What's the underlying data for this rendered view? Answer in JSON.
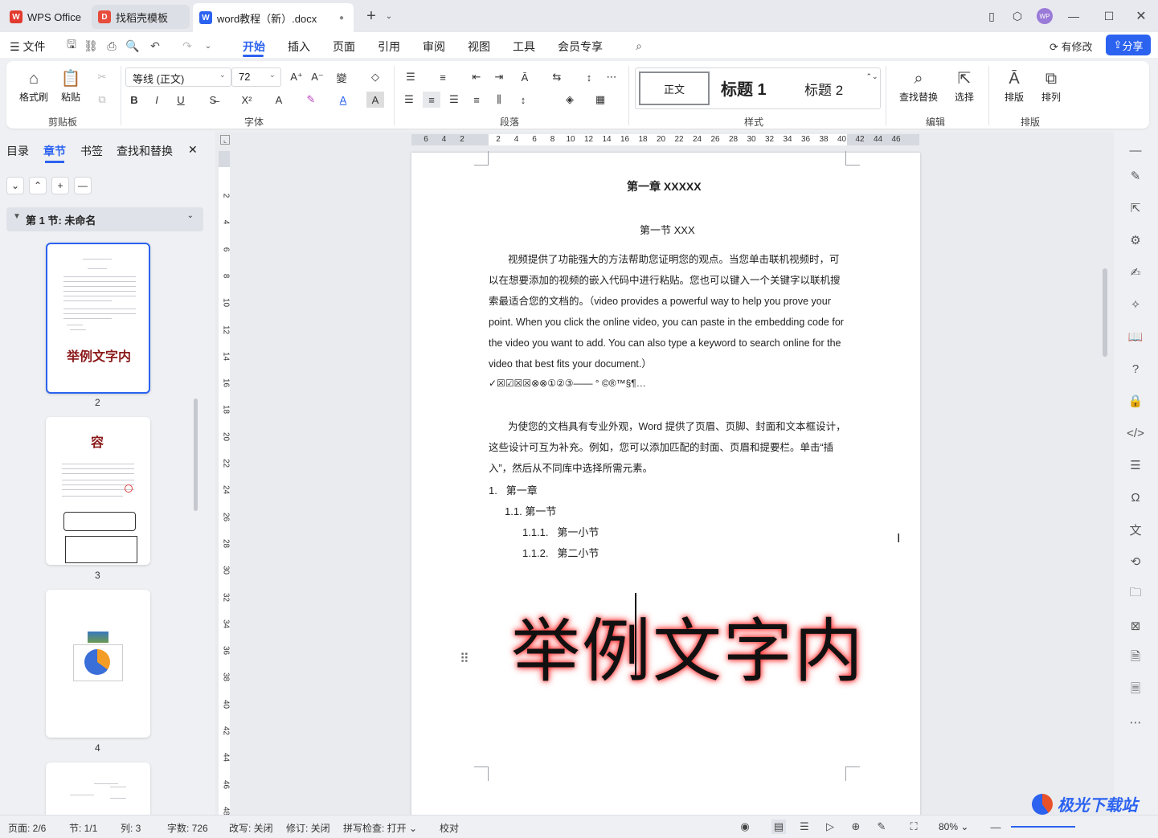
{
  "titlebar": {
    "tabs": [
      {
        "label": "WPS Office",
        "icon": "wps-logo-icon"
      },
      {
        "label": "找稻壳模板",
        "icon": "docer-icon"
      },
      {
        "label": "word教程（新）.docx",
        "icon": "word-doc-icon"
      }
    ],
    "new_tab": "+"
  },
  "menubar": {
    "file": "文件",
    "items": [
      "开始",
      "插入",
      "页面",
      "引用",
      "审阅",
      "视图",
      "工具",
      "会员专享"
    ],
    "active": "开始",
    "modified": "有修改",
    "share": "分享"
  },
  "ribbon": {
    "clipboard": {
      "label": "剪贴板",
      "format_painter": "格式刷",
      "paste": "粘贴"
    },
    "font": {
      "label": "字体",
      "family": "等线 (正文)",
      "size": "72"
    },
    "paragraph": {
      "label": "段落"
    },
    "styles": {
      "label": "样式",
      "normal": "正文",
      "h1": "标题 1",
      "h2": "标题 2"
    },
    "edit": {
      "label": "编辑",
      "find_replace": "查找替换",
      "select": "选择"
    },
    "arrange": {
      "label": "排版",
      "typeset": "排版",
      "arrange": "排列"
    }
  },
  "leftpanel": {
    "tabs": [
      "目录",
      "章节",
      "书签",
      "查找和替换"
    ],
    "active": "章节",
    "section": "第 1 节: 未命名",
    "thumbs": [
      {
        "num": "2",
        "text": "举例文字内"
      },
      {
        "num": "3",
        "text": "容"
      },
      {
        "num": "4",
        "text": ""
      }
    ]
  },
  "ruler": {
    "h": [
      "6",
      "4",
      "2",
      "",
      "2",
      "4",
      "6",
      "8",
      "10",
      "12",
      "14",
      "16",
      "18",
      "20",
      "22",
      "24",
      "26",
      "28",
      "30",
      "32",
      "34",
      "36",
      "38",
      "40",
      "42",
      "44",
      "46"
    ],
    "v": [
      "2",
      "4",
      "6",
      "8",
      "10",
      "12",
      "14",
      "16",
      "18",
      "20",
      "22",
      "24",
      "26",
      "28",
      "30",
      "32",
      "34",
      "36",
      "38",
      "40",
      "42",
      "44",
      "46",
      "48"
    ]
  },
  "document": {
    "chapter": "第一章  XXXXX",
    "section": "第一节  XXX",
    "para1": "视频提供了功能强大的方法帮助您证明您的观点。当您单击联机视频时，可以在想要添加的视频的嵌入代码中进行粘贴。您也可以键入一个关键字以联机搜索最适合您的文档的。（video provides a powerful way to help you prove your point. When you click the online video, you can paste in the embedding code for the video you want to add. You can also type a keyword to search online for the video that best fits your document.）",
    "symbols": "✓☒☑☒☒⊗⊗①②③——    °  ©®™§¶…",
    "para2": "为使您的文档具有专业外观，Word 提供了页眉、页脚、封面和文本框设计，这些设计可互为补充。例如，您可以添加匹配的封面、页眉和提要栏。单击“插入”，然后从不同库中选择所需元素。",
    "list": [
      {
        "num": "1.",
        "text": "第一章"
      },
      {
        "num": "1.1.",
        "text": "第一节"
      },
      {
        "num": "1.1.1.",
        "text": "第一小节"
      },
      {
        "num": "1.1.2.",
        "text": "第二小节"
      }
    ],
    "big_text": "举例文字内"
  },
  "statusbar": {
    "page": "页面: 2/6",
    "section": "节: 1/1",
    "column": "列: 3",
    "words": "字数: 726",
    "overwrite": "改写: 关闭",
    "revision": "修订: 关闭",
    "spellcheck": "拼写检查: 打开",
    "proofread": "校对",
    "zoom": "80%"
  },
  "watermark": "极光下载站"
}
